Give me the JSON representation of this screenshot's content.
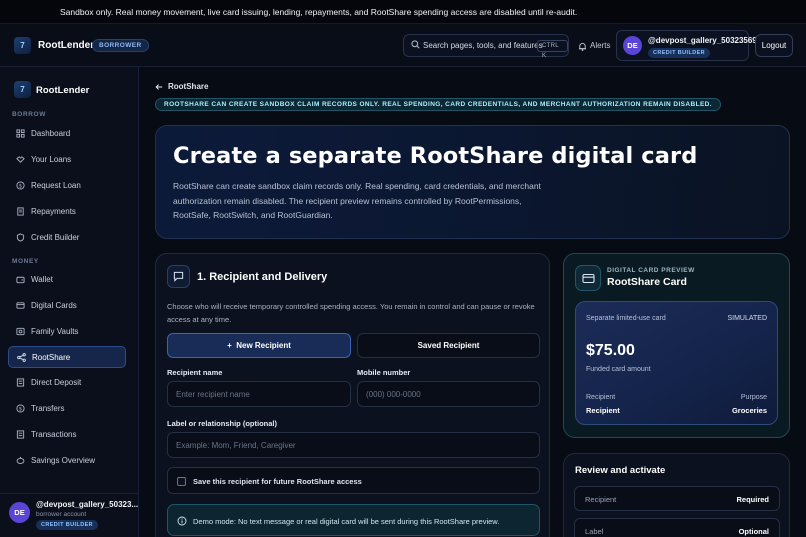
{
  "banner": {
    "text": "Sandbox only. Real money movement, live card issuing, lending, repayments, and RootShare spending access are disabled until re-audit."
  },
  "header": {
    "logo_mark": "7",
    "brand": "RootLender",
    "role_badge": "BORROWER",
    "search_label": "Search pages, tools, and features",
    "search_shortcut": "CTRL K",
    "alerts_label": "Alerts",
    "avatar_initials": "DE",
    "username": "@devpost_gallery_50323569",
    "user_badge": "CREDIT BUILDER",
    "logout_label": "Logout"
  },
  "sidebar": {
    "brand": "RootLender",
    "section_borrow": "BORROW",
    "section_money": "MONEY",
    "items": [
      {
        "label": "Dashboard",
        "icon": "grid-icon"
      },
      {
        "label": "Your Loans",
        "icon": "handshake-icon"
      },
      {
        "label": "Request Loan",
        "icon": "dollar-circle-icon"
      },
      {
        "label": "Repayments",
        "icon": "receipt-icon"
      },
      {
        "label": "Credit Builder",
        "icon": "shield-icon"
      },
      {
        "label": "Wallet",
        "icon": "wallet-icon"
      },
      {
        "label": "Digital Cards",
        "icon": "card-icon"
      },
      {
        "label": "Family Vaults",
        "icon": "vault-icon"
      },
      {
        "label": "RootShare",
        "icon": "share-icon"
      },
      {
        "label": "Direct Deposit",
        "icon": "deposit-icon"
      },
      {
        "label": "Transfers",
        "icon": "transfer-icon"
      },
      {
        "label": "Transactions",
        "icon": "list-icon"
      },
      {
        "label": "Savings Overview",
        "icon": "piggy-icon"
      }
    ],
    "active_item": "RootShare",
    "user": {
      "initials": "DE",
      "name": "@devpost_gallery_50323...",
      "account": "borrower account",
      "badge": "CREDIT BUILDER"
    }
  },
  "main": {
    "breadcrumb": "RootShare",
    "notice": "ROOTSHARE CAN CREATE SANDBOX CLAIM RECORDS ONLY. REAL SPENDING, CARD CREDENTIALS, AND MERCHANT AUTHORIZATION REMAIN DISABLED.",
    "hero": {
      "title": "Create a separate RootShare digital card",
      "description": "RootShare can create sandbox claim records only. Real spending, card credentials, and merchant authorization remain disabled. The recipient preview remains controlled by RootPermissions, RootSafe, RootSwitch, and RootGuardian."
    },
    "recipient": {
      "title": "1. Recipient and Delivery",
      "description": "Choose who will receive temporary controlled spending access. You remain in control and can pause or revoke access at any time.",
      "new_button": "New Recipient",
      "saved_button": "Saved Recipient",
      "name_label": "Recipient name",
      "name_placeholder": "Enter recipient name",
      "mobile_label": "Mobile number",
      "mobile_placeholder": "(000) 000-0000",
      "relationship_label": "Label or relationship (optional)",
      "relationship_placeholder": "Example: Mom, Friend, Caregiver",
      "save_label": "Save this recipient for future RootShare access",
      "demo_note": "Demo mode: No text message or real digital card will be sent during this RootShare preview."
    },
    "preview": {
      "kicker": "DIGITAL CARD PREVIEW",
      "title": "RootShare Card",
      "card_type": "Separate limited-use card",
      "status": "SIMULATED",
      "amount": "$75.00",
      "amount_caption": "Funded card amount",
      "recipient_label": "Recipient",
      "recipient_value": "Recipient",
      "purpose_label": "Purpose",
      "purpose_value": "Groceries"
    },
    "review": {
      "title": "Review and activate",
      "rows": [
        {
          "label": "Recipient",
          "value": "Required"
        },
        {
          "label": "Label",
          "value": "Optional"
        }
      ]
    }
  }
}
